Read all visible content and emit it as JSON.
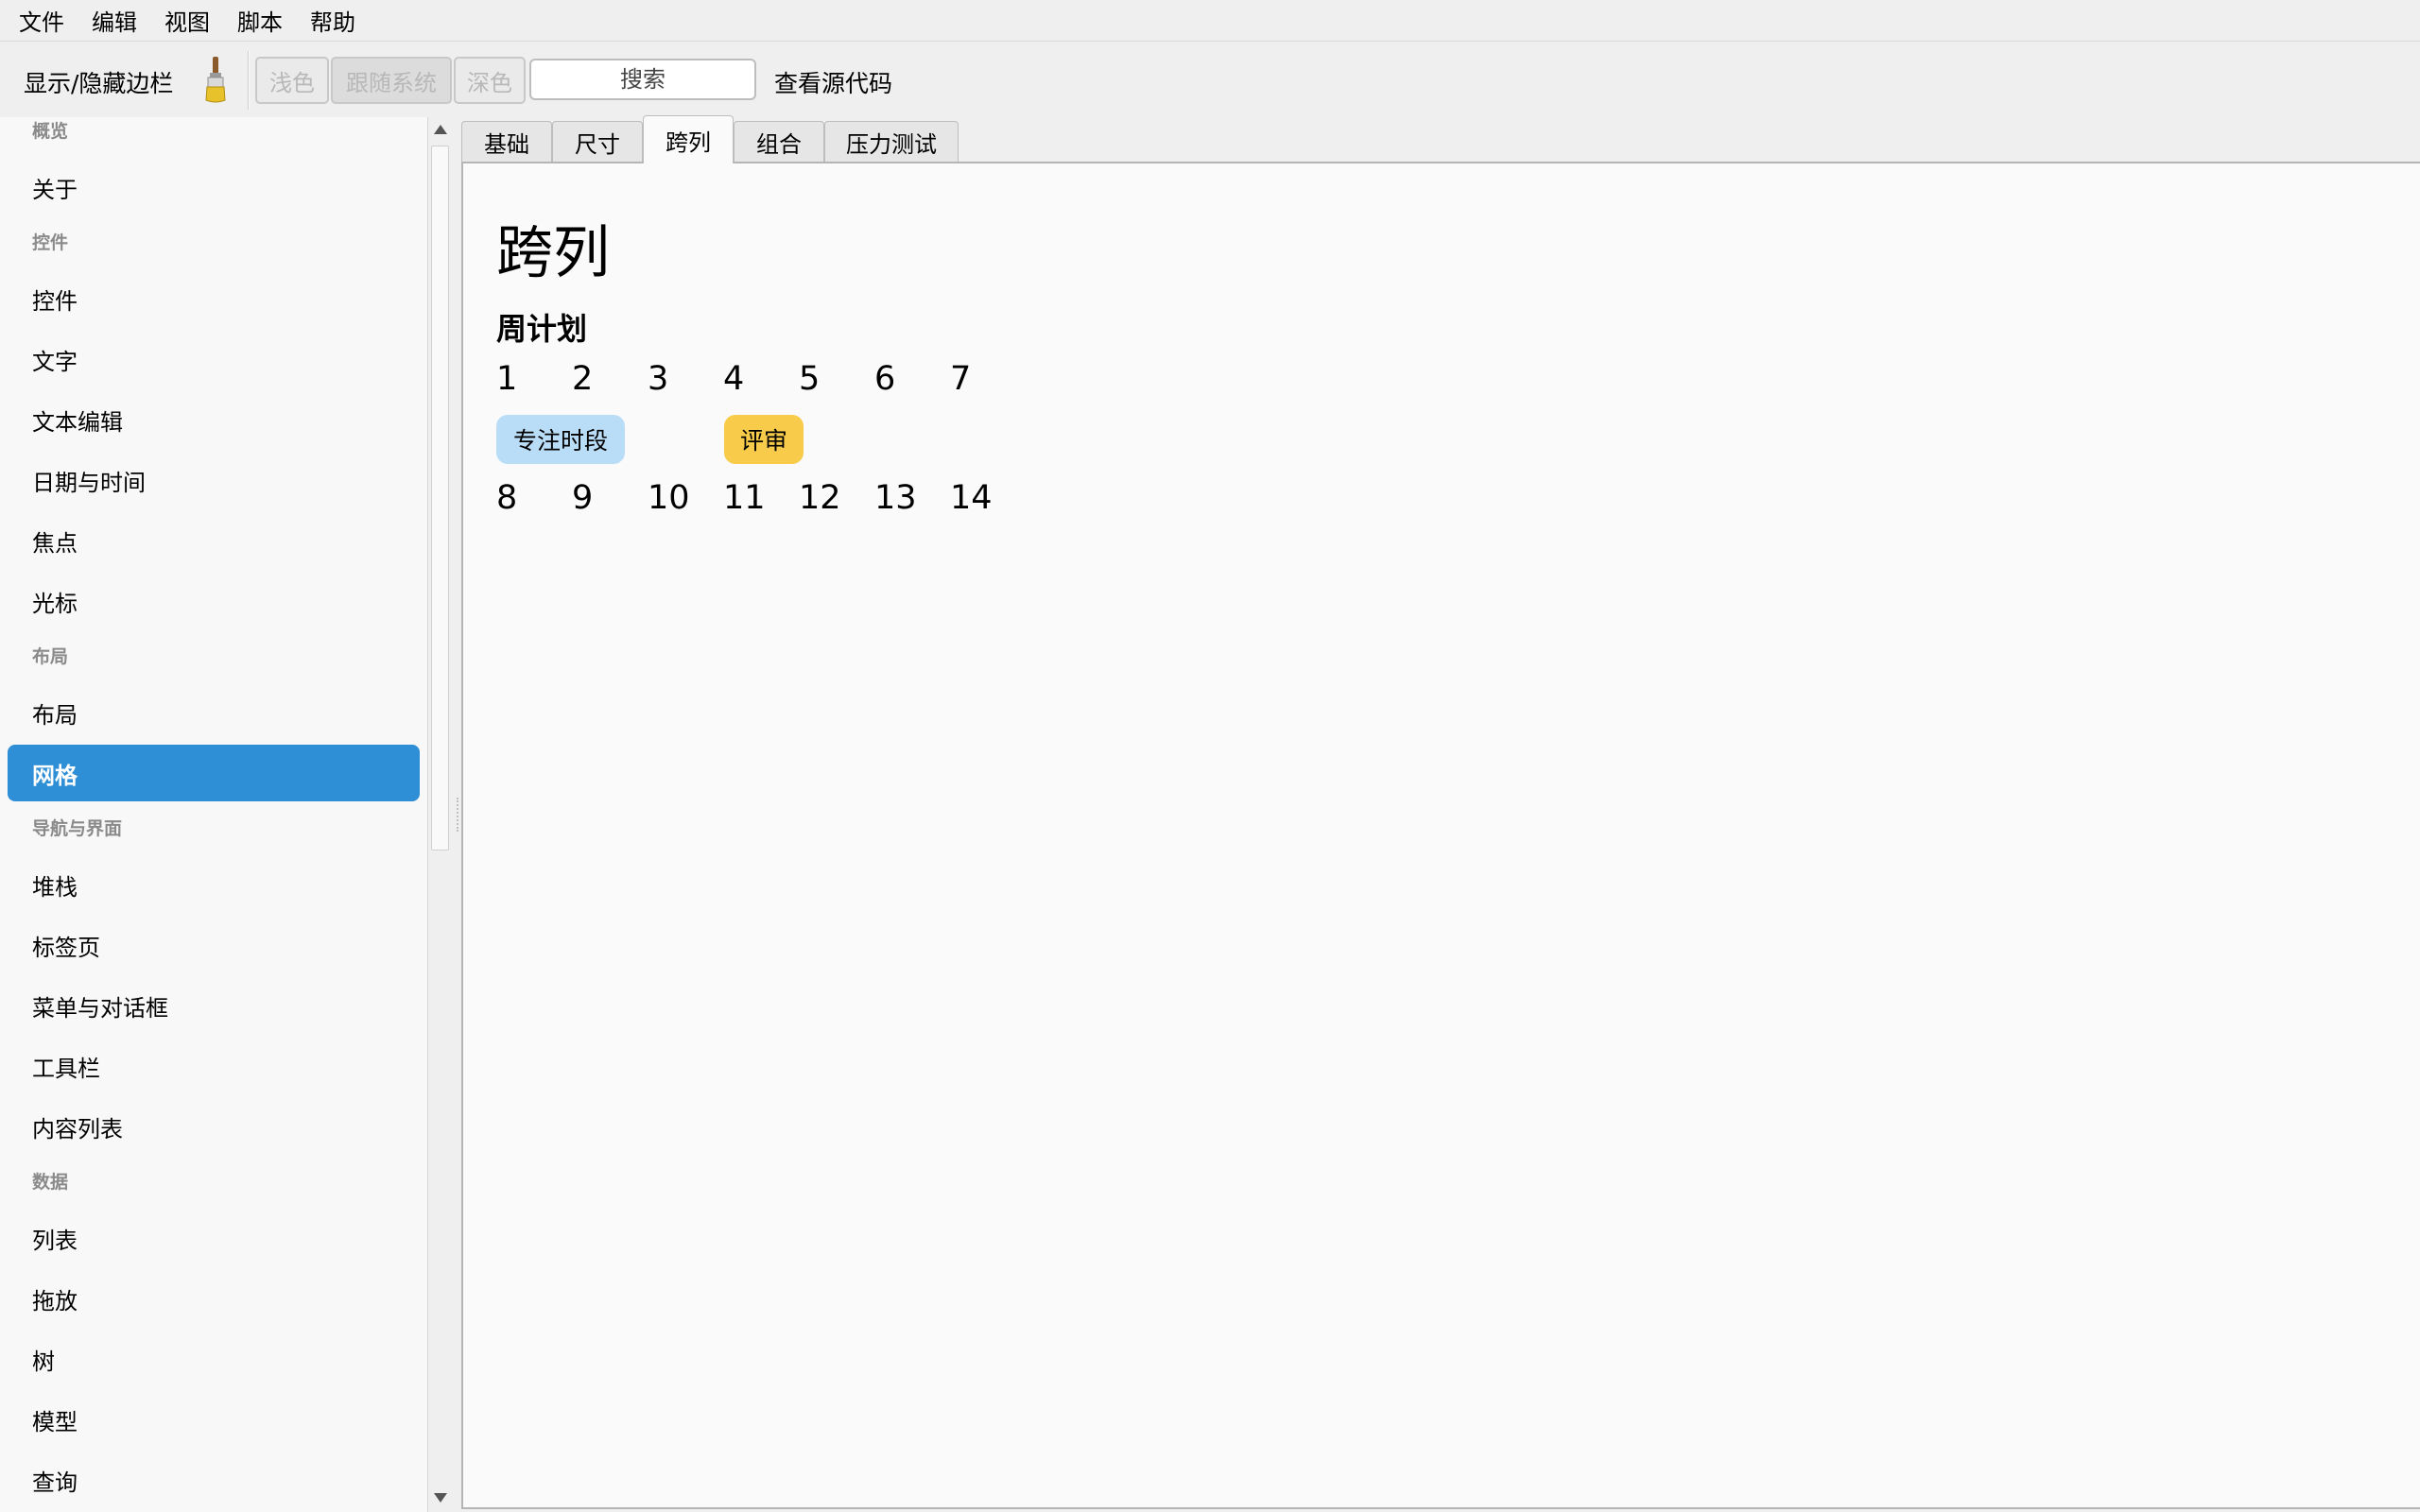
{
  "menubar": {
    "items": [
      "文件",
      "编辑",
      "视图",
      "脚本",
      "帮助"
    ]
  },
  "toolbar": {
    "sidebar_toggle": "显示/隐藏边栏",
    "theme_light": "浅色",
    "theme_system": "跟随系统",
    "theme_dark": "深色",
    "search_placeholder": "搜索",
    "view_source": "查看源代码"
  },
  "sidebar": {
    "sections": {
      "overview": "概览",
      "controls": "控件",
      "layout": "布局",
      "navigation": "导航与界面",
      "data": "数据"
    },
    "items": {
      "about": "关于",
      "controls": "控件",
      "text": "文字",
      "text_edit": "文本编辑",
      "datetime": "日期与时间",
      "focus": "焦点",
      "cursor": "光标",
      "layout": "布局",
      "grid": "网格",
      "stack": "堆栈",
      "tabs": "标签页",
      "menus_dialogs": "菜单与对话框",
      "toolbar": "工具栏",
      "content_list": "内容列表",
      "list": "列表",
      "drag_drop": "拖放",
      "tree": "树",
      "model": "模型",
      "query": "查询"
    },
    "selected": "网格"
  },
  "tabs": [
    "基础",
    "尺寸",
    "跨列",
    "组合",
    "压力测试"
  ],
  "active_tab": "跨列",
  "main": {
    "title": "跨列",
    "subtitle": "周计划",
    "week1": [
      "1",
      "2",
      "3",
      "4",
      "5",
      "6",
      "7"
    ],
    "week2": [
      "8",
      "9",
      "10",
      "11",
      "12",
      "13",
      "14"
    ],
    "events": [
      {
        "label": "专注时段",
        "color": "#b9dcf7"
      },
      {
        "label": "评审",
        "color": "#f8cc4a"
      }
    ]
  }
}
